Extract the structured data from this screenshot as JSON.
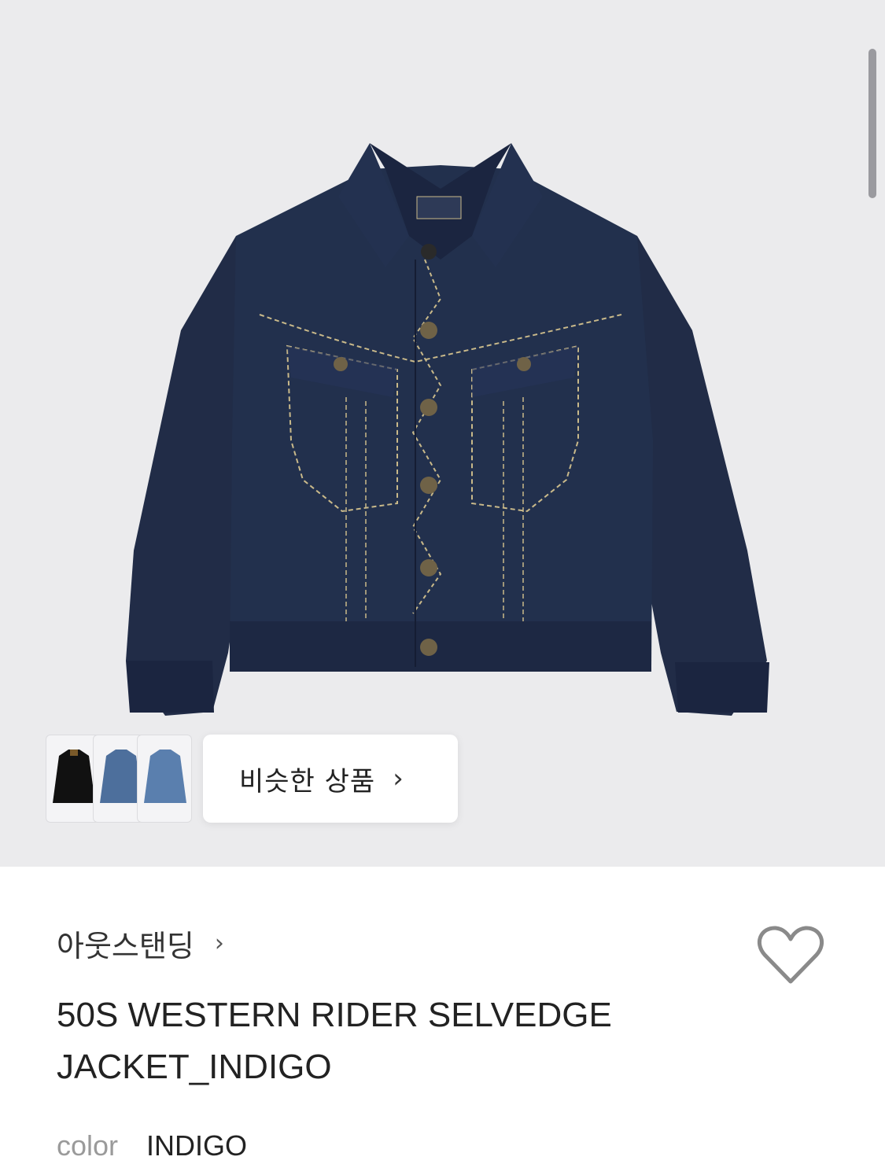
{
  "product_image": {
    "alt_icon": "denim-jacket-image"
  },
  "similar": {
    "label": "비슷한 상품",
    "chevron": "›"
  },
  "similar_thumbs": [
    "black-jacket-thumb",
    "light-denim-jacket-thumb",
    "mid-denim-jacket-thumb"
  ],
  "brand": {
    "name": "아웃스탠딩",
    "chevron": "›"
  },
  "product": {
    "title_line1": "50S WESTERN RIDER SELVEDGE",
    "title_line2": "JACKET_INDIGO"
  },
  "option": {
    "label": "color",
    "value": "INDIGO"
  },
  "colors": {
    "hero_bg": "#ebebed",
    "denim": "#1f2a44",
    "stitch": "#c9b98a"
  }
}
